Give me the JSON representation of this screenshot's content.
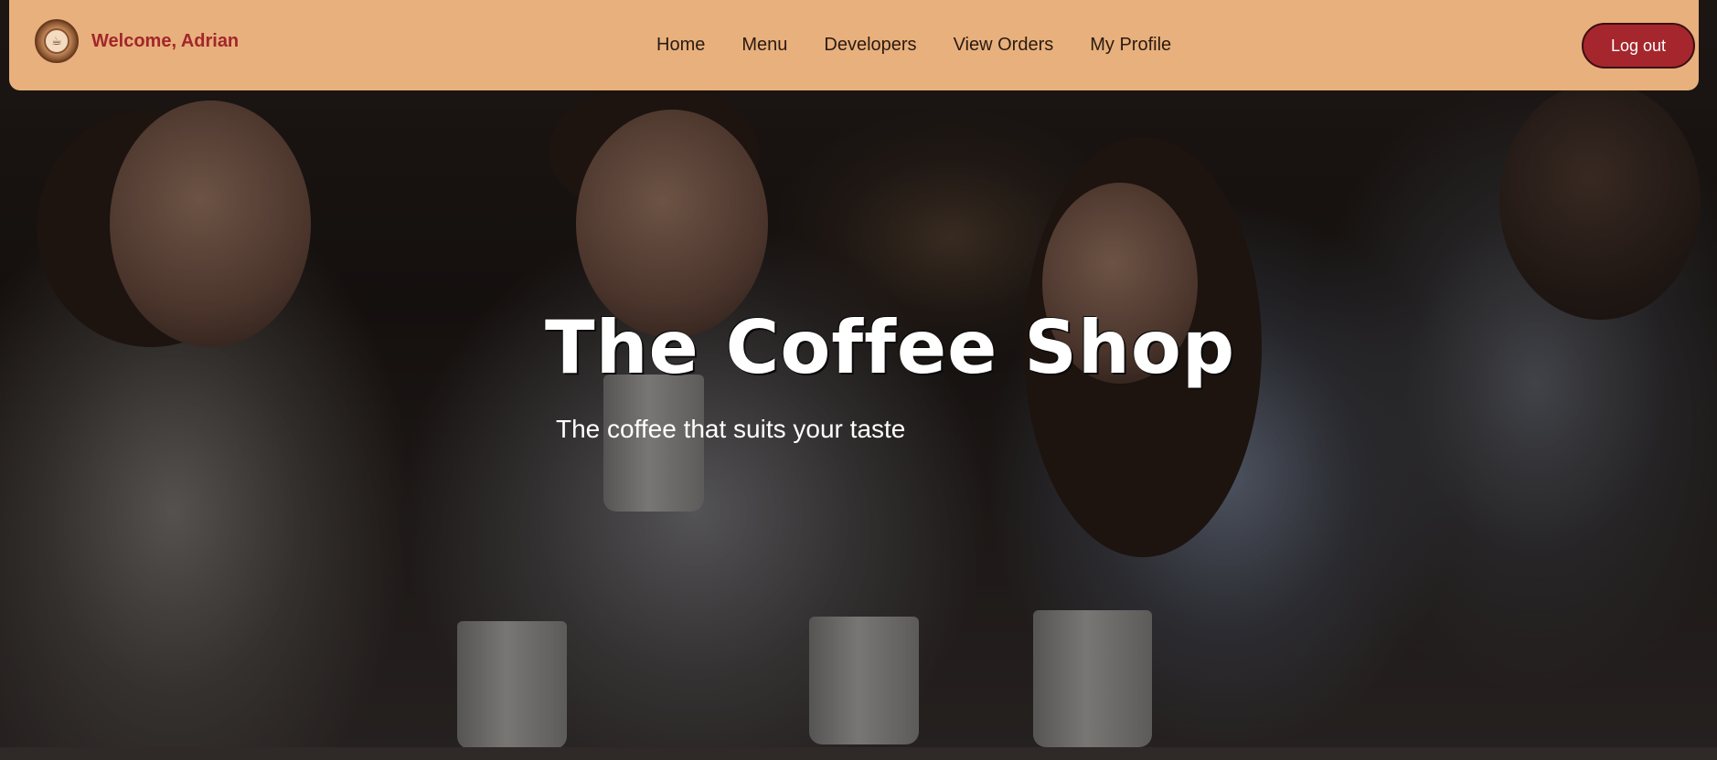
{
  "navbar": {
    "logo_icon": "coffee-shop-logo",
    "welcome_text": "Welcome, Adrian",
    "links": [
      {
        "label": "Home"
      },
      {
        "label": "Menu"
      },
      {
        "label": "Developers"
      },
      {
        "label": "View Orders"
      },
      {
        "label": "My Profile"
      }
    ],
    "logout_label": "Log out"
  },
  "hero": {
    "title": "The Coffee Shop",
    "subtitle": "The coffee that suits your taste"
  },
  "colors": {
    "navbar_bg": "#e8b07c",
    "welcome_text": "#a2262b",
    "logout_bg": "#a5262c"
  }
}
